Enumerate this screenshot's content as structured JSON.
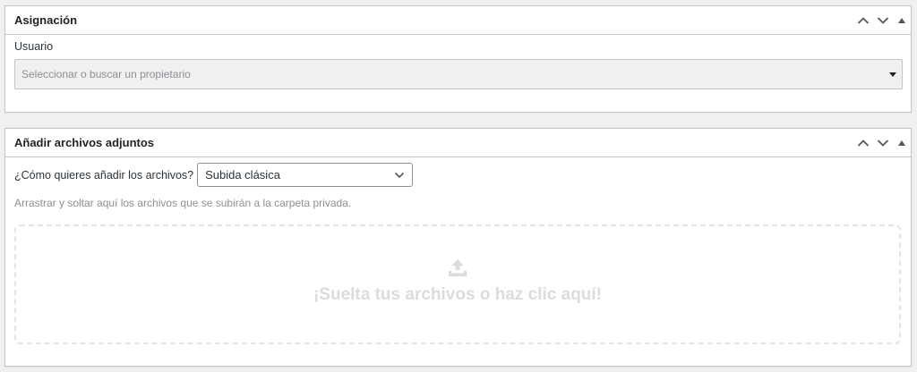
{
  "panels": {
    "assignment": {
      "title": "Asignación",
      "user_label": "Usuario",
      "owner_select": {
        "placeholder": "Seleccionar o buscar un propietario"
      }
    },
    "attachments": {
      "title": "Añadir archivos adjuntos",
      "method_label": "¿Cómo quieres añadir los archivos?",
      "method_select": {
        "value": "Subida clásica"
      },
      "hint": "Arrastrar y soltar aquí los archivos que se subirán a la carpeta privada.",
      "dropzone_text": "¡Suelta tus archivos o haz clic aquí!"
    }
  },
  "icons": {
    "move_up": "chevron-up-icon",
    "move_down": "chevron-down-icon",
    "toggle": "triangle-up-icon",
    "dropdown": "caret-down-icon",
    "upload": "upload-icon"
  },
  "colors": {
    "page_background": "#f0f0f1",
    "panel_border": "#c3c4c7",
    "title_text": "#1d2327",
    "placeholder_text": "#8c8f94",
    "dropzone_text": "#dcdcde"
  }
}
